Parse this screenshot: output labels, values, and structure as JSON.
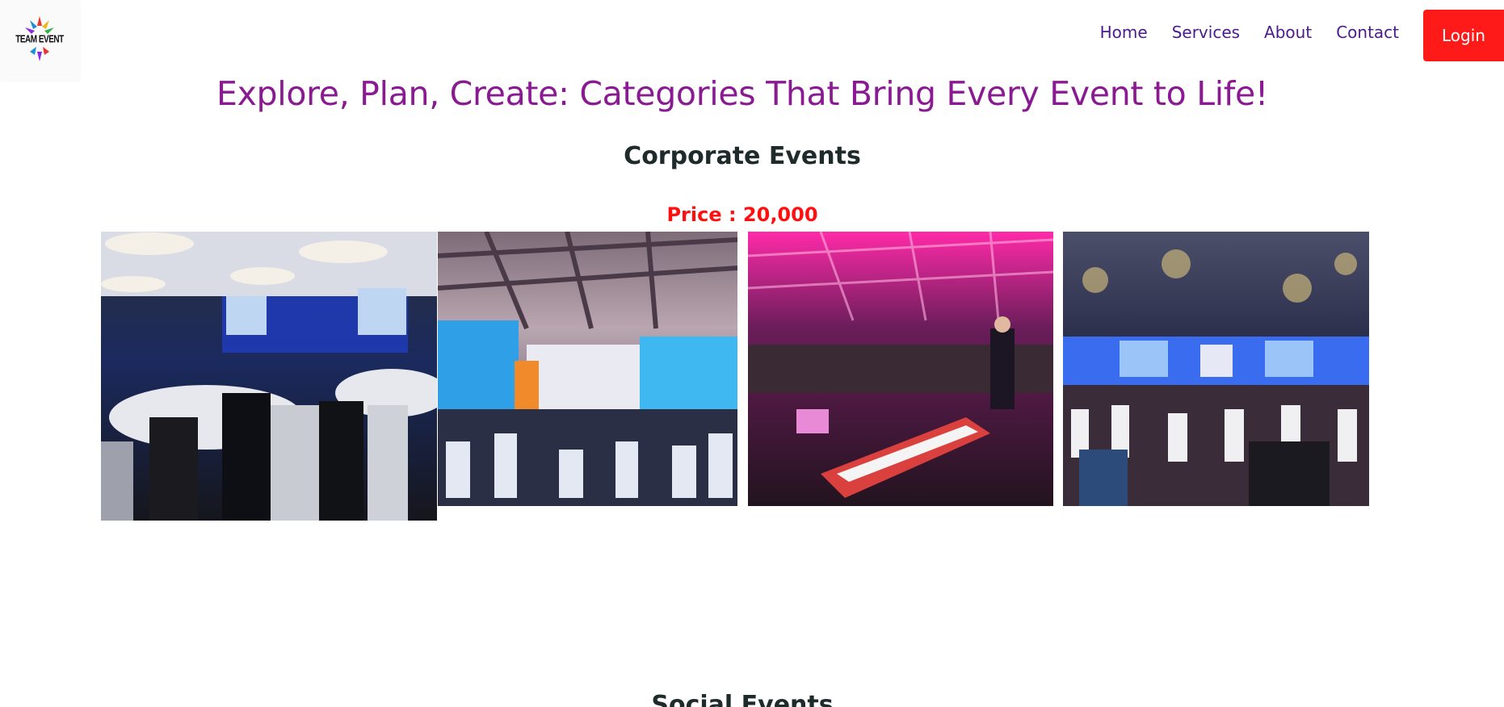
{
  "header": {
    "logo_text": "TEAM EVENT",
    "nav": [
      "Home",
      "Services",
      "About",
      "Contact"
    ],
    "login_label": "Login"
  },
  "main": {
    "headline": "Explore, Plan, Create: Categories That Bring Every Event to Life!",
    "sections": [
      {
        "title": "Corporate Events",
        "price": "Price : 20,000",
        "photos": [
          "banquet-hall-photo",
          "dinner-conference-photo",
          "pink-stage-keyboard-photo",
          "ballroom-presentation-photo"
        ]
      },
      {
        "title": "Social Events"
      }
    ]
  },
  "colors": {
    "nav_text": "#4b1a8c",
    "headline": "#8a1a92",
    "price": "#ff1010",
    "login_bg": "#ff1a1a"
  }
}
